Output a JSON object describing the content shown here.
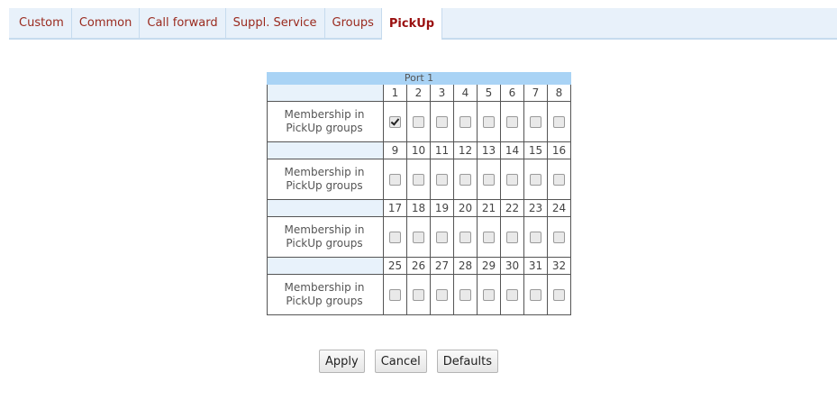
{
  "tabs": [
    {
      "label": "Custom",
      "active": false
    },
    {
      "label": "Common",
      "active": false
    },
    {
      "label": "Call forward",
      "active": false
    },
    {
      "label": "Suppl. Service",
      "active": false
    },
    {
      "label": "Groups",
      "active": false
    },
    {
      "label": "PickUp",
      "active": true
    }
  ],
  "port_table": {
    "title": "Port 1",
    "row_label": "Membership in PickUp groups",
    "blocks": [
      {
        "numbers": [
          "1",
          "2",
          "3",
          "4",
          "5",
          "6",
          "7",
          "8"
        ],
        "checked": [
          true,
          false,
          false,
          false,
          false,
          false,
          false,
          false
        ]
      },
      {
        "numbers": [
          "9",
          "10",
          "11",
          "12",
          "13",
          "14",
          "15",
          "16"
        ],
        "checked": [
          false,
          false,
          false,
          false,
          false,
          false,
          false,
          false
        ]
      },
      {
        "numbers": [
          "17",
          "18",
          "19",
          "20",
          "21",
          "22",
          "23",
          "24"
        ],
        "checked": [
          false,
          false,
          false,
          false,
          false,
          false,
          false,
          false
        ]
      },
      {
        "numbers": [
          "25",
          "26",
          "27",
          "28",
          "29",
          "30",
          "31",
          "32"
        ],
        "checked": [
          false,
          false,
          false,
          false,
          false,
          false,
          false,
          false
        ]
      }
    ]
  },
  "buttons": {
    "apply": "Apply",
    "cancel": "Cancel",
    "defaults": "Defaults"
  }
}
